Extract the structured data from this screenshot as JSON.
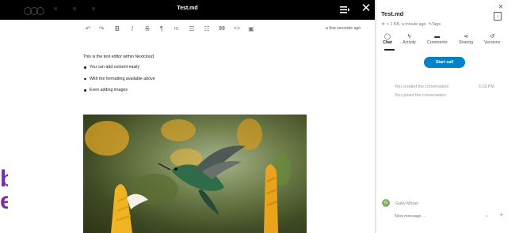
{
  "window": {
    "title": "Test.md"
  },
  "background": {
    "partial_text_1": "bora",
    "partial_text_2": "e"
  },
  "toolbar": {
    "icons": [
      "undo-icon",
      "redo-icon",
      "bold-icon",
      "italic-icon",
      "strikethrough-icon",
      "paragraph-icon",
      "heading-icon",
      "bullet-list-icon",
      "numbered-list-icon",
      "quote-icon",
      "code-icon",
      "image-icon"
    ],
    "undo_glyph": "↶",
    "redo_glyph": "↷",
    "bold_glyph": "B",
    "italic_glyph": "I",
    "strike_glyph": "S",
    "para_glyph": "¶",
    "heading_glyph": "H1",
    "ul_glyph": "☰",
    "ol_glyph": "☷",
    "quote_glyph": "99",
    "code_glyph": "<>",
    "image_glyph": "▣",
    "saved_status": "a few seconds ago"
  },
  "document": {
    "paragraph": "This is the text editor within Nextcloud",
    "bullets": [
      "You can add content easily",
      "With the formatting available above",
      "Even adding images"
    ]
  },
  "sidebar": {
    "title": "Test.md",
    "meta": "< 1 KB, a minute ago",
    "tags_label": "Tags",
    "tabs": [
      {
        "label": "Chat",
        "icon": "chat-icon",
        "glyph": "◯"
      },
      {
        "label": "Activity",
        "icon": "activity-icon",
        "glyph": "ϟ"
      },
      {
        "label": "Comments",
        "icon": "comments-icon",
        "glyph": "▬"
      },
      {
        "label": "Sharing",
        "icon": "share-icon",
        "glyph": "⋖"
      },
      {
        "label": "Versions",
        "icon": "history-icon",
        "glyph": "↺"
      }
    ],
    "start_call": "Start call",
    "messages": [
      {
        "text": "You created the conversation",
        "time": "5:18 PM"
      },
      {
        "text": "You joined the conversation"
      }
    ],
    "author_initial": "G",
    "author_name": "Gaby Moran",
    "input_placeholder": "New message ...",
    "send_glyph": "→",
    "plus_glyph": "+"
  },
  "colors": {
    "accent": "#0082c9",
    "topbar": "#000000",
    "avatar": "#7fb069",
    "brand_purple": "#7b2fa6"
  }
}
